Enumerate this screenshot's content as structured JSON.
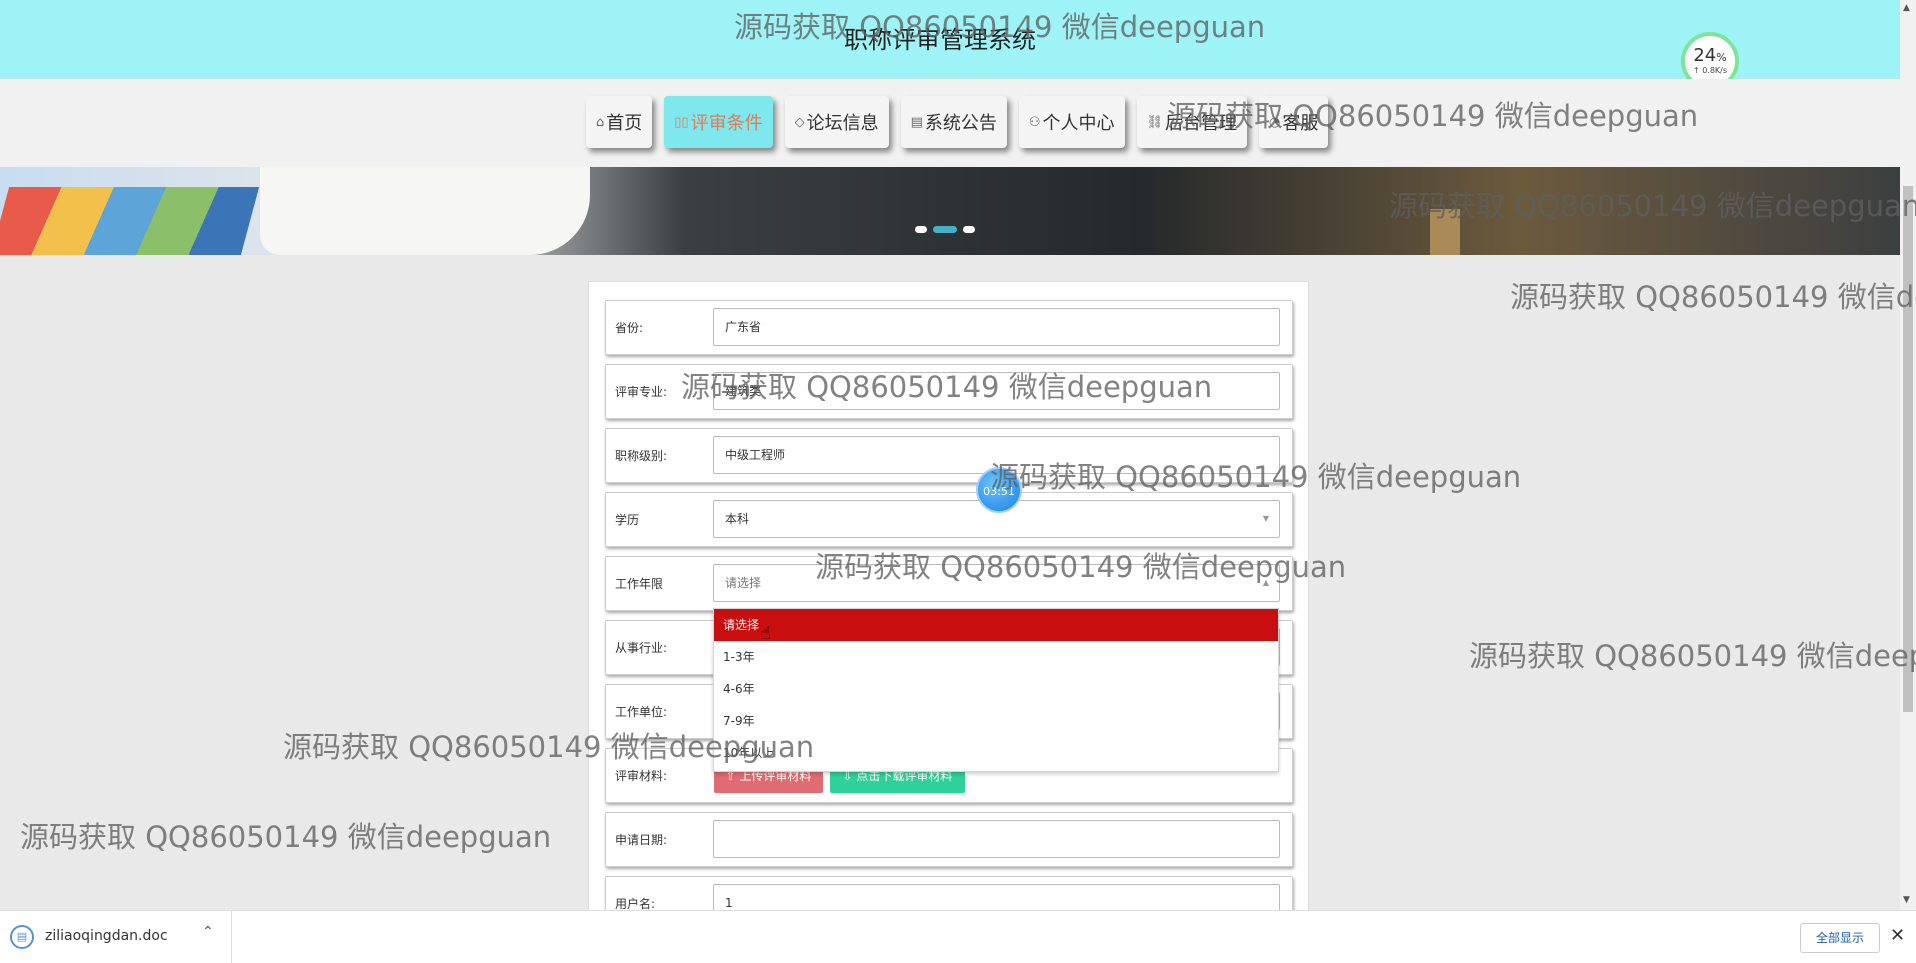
{
  "app_title": "职称评审管理系统",
  "speed": {
    "percent": "24",
    "percent_sign": "%",
    "rate": "↑ 0.8K/s"
  },
  "nav": {
    "items": [
      {
        "icon": "⌂",
        "label": "首页"
      },
      {
        "icon": "▯▯",
        "label": "评审条件"
      },
      {
        "icon": "◇",
        "label": "论坛信息"
      },
      {
        "icon": "▤",
        "label": "系统公告"
      },
      {
        "icon": "⚇",
        "label": "个人中心"
      },
      {
        "icon": "⛓",
        "label": "后台管理"
      },
      {
        "icon": "◔",
        "label": "客服"
      }
    ],
    "active_index": 1
  },
  "form": {
    "province": {
      "label": "省份:",
      "value": "广东省"
    },
    "major": {
      "label": "评审专业:",
      "value": "建筑类"
    },
    "title_level": {
      "label": "职称级别:",
      "value": "中级工程师"
    },
    "education": {
      "label": "学历",
      "value": "本科"
    },
    "work_years": {
      "label": "工作年限",
      "placeholder": "请选择"
    },
    "industry": {
      "label": "从事行业:"
    },
    "work_unit": {
      "label": "工作单位:"
    },
    "materials": {
      "label": "评审材料:",
      "upload_button": "上传评审材料",
      "download_button": "点击下载评审材料"
    },
    "apply_date": {
      "label": "申请日期:",
      "value": ""
    },
    "username": {
      "label": "用户名:",
      "value": "1"
    }
  },
  "dropdown": {
    "options": [
      "请选择",
      "1-3年",
      "4-6年",
      "7-9年",
      "10年以上"
    ],
    "highlighted_index": 0
  },
  "timer": "03:51",
  "watermark_text": "源码获取 QQ86050149 微信deepguan",
  "download_bar": {
    "file_name": "ziliaoqingdan.doc",
    "show_all": "全部显示",
    "close": "✕"
  },
  "colors": {
    "header": "#9ef3f7",
    "active_nav": "#7fe8ee",
    "dropdown_highlight": "#c80e0e",
    "upload": "#e06b73",
    "download": "#2ed19a"
  }
}
